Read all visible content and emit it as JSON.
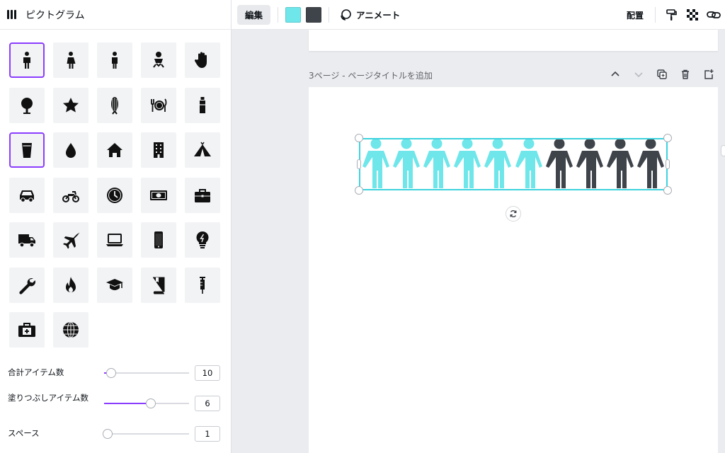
{
  "panel": {
    "title": "ピクトグラム",
    "icons": [
      "person-icon",
      "woman-icon",
      "man-icon",
      "baby-icon",
      "hand-icon",
      "tree-icon",
      "star-icon",
      "corn-icon",
      "dining-icon",
      "bottle-icon",
      "glass-icon",
      "water-drop-icon",
      "house-icon",
      "building-icon",
      "tent-icon",
      "car-icon",
      "motorcycle-icon",
      "clock-icon",
      "money-icon",
      "briefcase-icon",
      "truck-icon",
      "airplane-icon",
      "laptop-icon",
      "smartphone-icon",
      "lightbulb-icon",
      "wrench-icon",
      "fire-icon",
      "graduation-cap-icon",
      "book-icon",
      "syringe-icon",
      "first-aid-kit-icon",
      "globe-icon"
    ],
    "selected_icons": [
      "person-icon",
      "glass-icon"
    ],
    "controls": {
      "total": {
        "label": "合計アイテム数",
        "value": "10",
        "fraction": 0.08
      },
      "filled": {
        "label": "塗りつぶしアイテム数",
        "value": "6",
        "fraction": 0.6
      },
      "space": {
        "label": "スペース",
        "value": "1",
        "fraction": 0.05
      }
    }
  },
  "toolbar": {
    "edit_label": "編集",
    "color1": "#6ee6ea",
    "color2": "#3f444b",
    "animate_label": "アニメート",
    "arrange_label": "配置"
  },
  "canvas": {
    "page_label": "3ページ - ページタイトルを追加",
    "filled_color": "#6ee6ea",
    "empty_color": "#3f444b",
    "total_items": 10,
    "filled_items": 6
  }
}
